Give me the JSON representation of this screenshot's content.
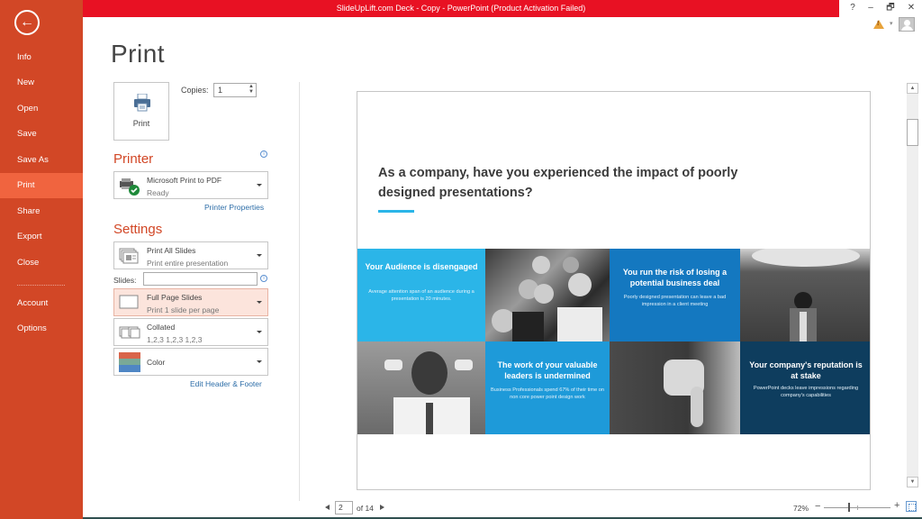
{
  "window": {
    "title": "SlideUpLift.com Deck - Copy -  PowerPoint (Product Activation Failed)",
    "help": "?",
    "minimize": "–",
    "restore": "🗗",
    "close": "✕",
    "warning_glyph": "!",
    "warning_dropdown": "▾"
  },
  "nav": {
    "back": "←",
    "items": [
      {
        "label": "Info"
      },
      {
        "label": "New"
      },
      {
        "label": "Open"
      },
      {
        "label": "Save"
      },
      {
        "label": "Save As"
      },
      {
        "label": "Print",
        "active": true
      },
      {
        "label": "Share"
      },
      {
        "label": "Export"
      },
      {
        "label": "Close"
      },
      {
        "label": "Account"
      },
      {
        "label": "Options"
      }
    ]
  },
  "print": {
    "page_title": "Print",
    "print_button": "Print",
    "copies_label": "Copies:",
    "copies_value": "1",
    "spin": "▲\n▼",
    "printer_heading": "Printer",
    "printer_name": "Microsoft Print to PDF",
    "printer_status": "Ready",
    "printer_properties": "Printer Properties",
    "info": "i",
    "settings_heading": "Settings",
    "settings": [
      {
        "title": "Print All Slides",
        "subtitle": "Print entire presentation",
        "icon": "slides-stack-icon"
      },
      {
        "title": "Full Page Slides",
        "subtitle": "Print 1 slide per page",
        "icon": "full-page-icon",
        "selected": true
      },
      {
        "title": "Collated",
        "subtitle": "1,2,3    1,2,3    1,2,3",
        "icon": "collated-icon"
      },
      {
        "title": "Color",
        "subtitle": "",
        "icon": "color-icon"
      }
    ],
    "slides_label": "Slides:",
    "slides_value": "",
    "edit_header_footer": "Edit Header & Footer"
  },
  "preview": {
    "heading": "As a company, have you experienced the impact of poorly designed  presentations?",
    "accent_color": "#2bb5e8",
    "tiles": [
      {
        "title": "Your Audience is disengaged",
        "body": "Average attention span of an audience during a presentation is 20 minutes.",
        "color": "#2bb5e8"
      },
      {
        "title": "You run the risk of losing a potential business deal",
        "body": "Poorly designed presentation can leave a bad impression in a client meeting",
        "color": "#1478c0"
      },
      {
        "title": "The work of your valuable leaders is undermined",
        "body": "Business Professionals spend 67% of their time on non core power point design work",
        "color": "#1e9ad9"
      },
      {
        "title": "Your company's reputation is at stake",
        "body": "PowerPoint decks leave impressions regarding company's capabilities",
        "color": "#0e3d5e"
      }
    ],
    "photos": [
      "audience-photo",
      "stressed-man-photo",
      "man-covering-ears-photo",
      "thumbs-down-photo"
    ]
  },
  "pager": {
    "current_page": "2",
    "of_label": "of 14"
  },
  "zoom": {
    "percent_label": "72%",
    "percent": 72,
    "minus": "−",
    "plus": "+"
  },
  "scrollbar": {
    "up": "▲",
    "down": "▼"
  }
}
